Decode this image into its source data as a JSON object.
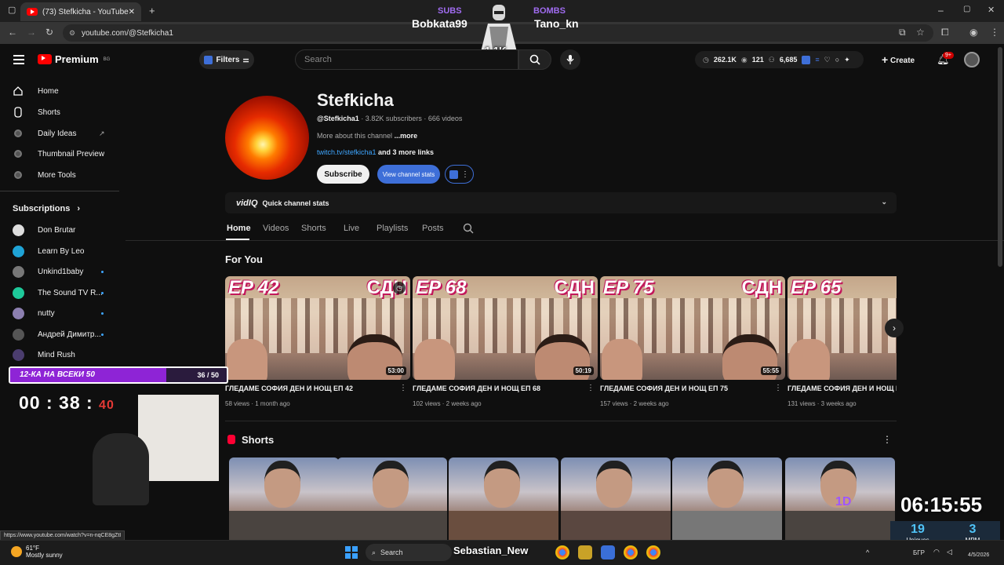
{
  "browser": {
    "tab_title": "(73) Stefkicha - YouTube",
    "url": "youtube.com/@Stefkicha1"
  },
  "yt": {
    "logo": "Premium",
    "logo_region": "BG",
    "filters": "Filters",
    "search_placeholder": "Search",
    "stats": [
      "262.1K",
      "121",
      "6,685"
    ],
    "create": "Create",
    "notifications": "9+"
  },
  "overlay": {
    "subs_label": "SUBS",
    "bombs_label": "BOMBS",
    "subs_name": "Bobkata99",
    "bombs_name": "Tano_kn",
    "count": "1.1K",
    "goal_label": "12-КА НА ВСЕКИ 50",
    "goal_count": "36 / 50",
    "goal_progress": 0.72,
    "timer_main": "00 : 38 :",
    "timer_sec": "40",
    "clock": "06:15:55",
    "uniques_value": "19",
    "uniques_label": "Uniques",
    "mpm_value": "3",
    "mpm_label": "MPM",
    "taskbar_name": "Sebastian_New",
    "shorts_tag": "1D"
  },
  "sidebar": {
    "items": [
      "Home",
      "Shorts",
      "Daily Ideas",
      "Thumbnail Preview",
      "More Tools"
    ],
    "subs_title": "Subscriptions",
    "subscriptions": [
      "Don Brutar",
      "Learn By Leo",
      "Unkind1baby",
      "The Sound TV R...",
      "nutty",
      "Андрей Димитр...",
      "Mind Rush"
    ]
  },
  "channel": {
    "name": "Stefkicha",
    "handle": "@Stefkicha1",
    "subs_videos": " · 3.82K subscribers · 666 videos",
    "desc": "More about this channel",
    "more": "...more",
    "link": "twitch.tv/stefkicha1",
    "more_links": " and 3 more links",
    "subscribe": "Subscribe",
    "view_stats": "View channel stats",
    "vidiq": "vidIQ",
    "quick_stats": "Quick channel stats",
    "tabs": [
      "Home",
      "Videos",
      "Shorts",
      "Live",
      "Playlists",
      "Posts"
    ],
    "for_you": "For You",
    "shorts_title": "Shorts"
  },
  "videos": [
    {
      "ep": "EP 42",
      "tag": "СДН",
      "duration": "53:00",
      "title": "ГЛЕДАМЕ СОФИЯ ДЕН И НОЩ ЕП 42",
      "meta": "58 views · 1 month ago"
    },
    {
      "ep": "EP 68",
      "tag": "СДН",
      "duration": "50:19",
      "title": "ГЛЕДАМЕ СОФИЯ ДЕН И НОЩ ЕП 68",
      "meta": "102 views · 2 weeks ago"
    },
    {
      "ep": "EP 75",
      "tag": "СДН",
      "duration": "55:55",
      "title": "ГЛЕДАМЕ СОФИЯ ДЕН И НОЩ ЕП 75",
      "meta": "157 views · 2 weeks ago"
    },
    {
      "ep": "EP 65",
      "tag": "",
      "duration": "",
      "title": "ГЛЕДАМЕ СОФИЯ ДЕН И НОЩ ЕП",
      "meta": "131 views · 3 weeks ago"
    }
  ],
  "status_url": "https://www.youtube.com/watch?v=n-nqCE8gZtI",
  "taskbar": {
    "weather_temp": "61°F",
    "weather_desc": "Mostly sunny",
    "search": "Search",
    "lang": "БГР",
    "date": "4/5/2026"
  }
}
